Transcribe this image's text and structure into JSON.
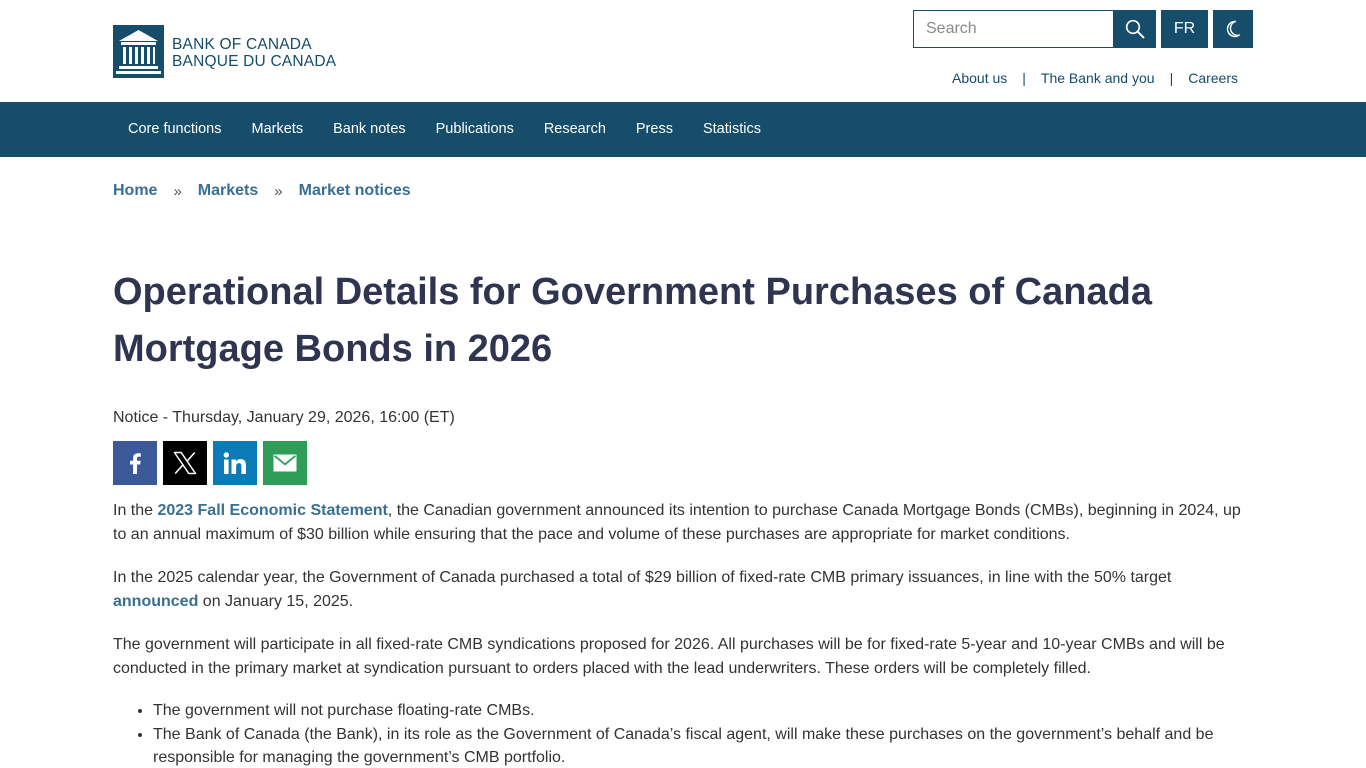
{
  "header": {
    "logo": {
      "line1": "BANK OF CANADA",
      "line2": "BANQUE DU CANADA"
    },
    "search": {
      "placeholder": "Search",
      "icon": "search-icon"
    },
    "lang_button": "FR",
    "theme_icon": "moon-icon",
    "util_links": [
      {
        "label": "About us"
      },
      {
        "label": "The Bank and you"
      },
      {
        "label": "Careers"
      }
    ],
    "util_separator": "|"
  },
  "nav": {
    "items": [
      {
        "label": "Core functions"
      },
      {
        "label": "Markets"
      },
      {
        "label": "Bank notes"
      },
      {
        "label": "Publications"
      },
      {
        "label": "Research"
      },
      {
        "label": "Press"
      },
      {
        "label": "Statistics"
      }
    ]
  },
  "breadcrumb": {
    "items": [
      {
        "label": "Home"
      },
      {
        "label": "Markets"
      },
      {
        "label": "Market notices"
      }
    ],
    "separator": "»"
  },
  "page": {
    "title": "Operational Details for Government Purchases of Canada Mortgage Bonds in 2026",
    "meta": "Notice - Thursday, January 29, 2026, 16:00 (ET)"
  },
  "share": {
    "icons": [
      "facebook-icon",
      "x-icon",
      "linkedin-icon",
      "email-icon"
    ]
  },
  "content": {
    "p1_before": "In the ",
    "p1_link": "2023 Fall Economic Statement",
    "p1_after": ", the Canadian government announced its intention to purchase Canada Mortgage Bonds (CMBs), beginning in 2024, up to an annual maximum of $30 billion while ensuring that the pace and volume of these purchases are appropriate for market conditions.",
    "p2_before": "In the 2025 calendar year, the Government of Canada purchased a total of $29 billion of fixed-rate CMB primary issuances, in line with the 50% target ",
    "p2_link": "announced",
    "p2_after": " on January 15, 2025.",
    "p3": "The government will participate in all fixed-rate CMB syndications proposed for 2026. All purchases will be for fixed-rate 5-year and 10-year CMBs and will be conducted in the primary market at syndication pursuant to orders placed with the lead underwriters. These orders will be completely filled.",
    "bullets": [
      "The government will not purchase floating-rate CMBs.",
      "The Bank of Canada (the Bank), in its role as the Government of Canada’s fiscal agent, will make these purchases on the government’s behalf and be responsible for managing the government’s CMB portfolio."
    ]
  },
  "colors": {
    "brand": "#154d6b",
    "link": "#3a6f92",
    "title": "#2f3550",
    "facebook": "#3b5998",
    "x": "#000000",
    "linkedin": "#0a7bb6",
    "email": "#2e9d57"
  }
}
